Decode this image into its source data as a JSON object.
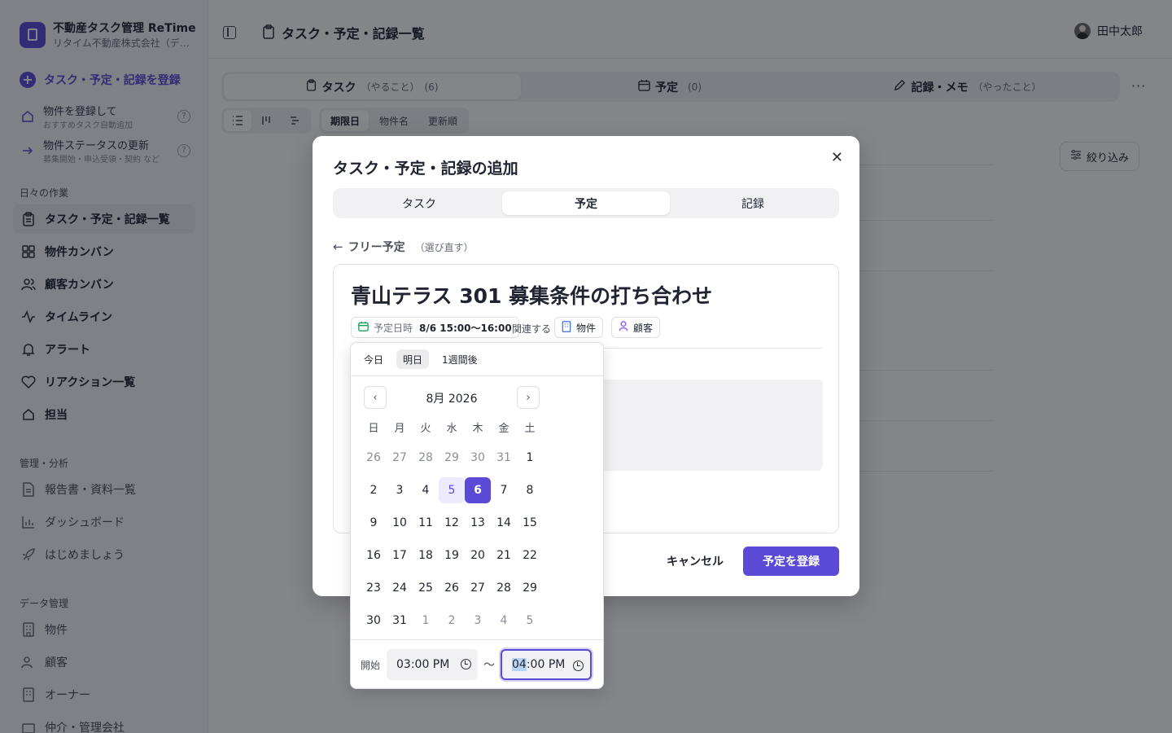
{
  "app": {
    "name": "不動産タスク管理 ReTime",
    "company": "リタイム不動産株式会社（デ…"
  },
  "sidebar": {
    "primary_cta": "タスク・予定・記録を登録",
    "sub_ctas": [
      {
        "title": "物件を登録して",
        "subtitle": "おすすめタスク自動追加"
      },
      {
        "title": "物件ステータスの更新",
        "subtitle": "募集開始・申込受領・契約 など"
      }
    ],
    "help_glyph": "?",
    "sections": [
      {
        "title": "日々の作業",
        "items": [
          "タスク・予定・記録一覧",
          "物件カンバン",
          "顧客カンバン",
          "タイムライン",
          "アラート",
          "リアクション一覧",
          "担当"
        ]
      },
      {
        "title": "管理・分析",
        "items": [
          "報告書・資料一覧",
          "ダッシュボード",
          "はじめましょう"
        ]
      },
      {
        "title": "データ管理",
        "items": [
          "物件",
          "顧客",
          "オーナー",
          "仲介・管理会社"
        ]
      }
    ]
  },
  "header": {
    "title": "タスク・予定・記録一覧",
    "user_name": "田中太郎"
  },
  "main": {
    "tabs": [
      {
        "label": "タスク",
        "sub": "（やること）",
        "count": "(6)"
      },
      {
        "label": "予定",
        "sub": "",
        "count": "(0)"
      },
      {
        "label": "記録・メモ",
        "sub": "（やったこと）",
        "count": ""
      }
    ],
    "sort_options": [
      "期限日",
      "物件名",
      "更新順"
    ],
    "filter_label": "絞り込み",
    "more_glyph": "···"
  },
  "modal": {
    "title": "タスク・予定・記録の追加",
    "close_glyph": "✕",
    "segments": [
      "タスク",
      "予定",
      "記録"
    ],
    "back_label": "フリー予定",
    "back_hint": "（選び直す）",
    "event_title": "青山テラス 301 募集条件の打ち合わせ",
    "schedule_key": "予定日時",
    "schedule_value": "8/6 15:00〜16:00",
    "relate_label": "関連する",
    "relate_property": "物件",
    "relate_customer": "顧客",
    "cancel_label": "キャンセル",
    "submit_label": "予定を登録"
  },
  "datepicker": {
    "quick": [
      "今日",
      "明日",
      "1週間後"
    ],
    "month_label": "8月 2026",
    "prev_glyph": "‹",
    "next_glyph": "›",
    "weekdays": [
      "日",
      "月",
      "火",
      "水",
      "木",
      "金",
      "土"
    ],
    "weeks": [
      [
        "26",
        "27",
        "28",
        "29",
        "30",
        "31",
        "1"
      ],
      [
        "2",
        "3",
        "4",
        "5",
        "6",
        "7",
        "8"
      ],
      [
        "9",
        "10",
        "11",
        "12",
        "13",
        "14",
        "15"
      ],
      [
        "16",
        "17",
        "18",
        "19",
        "20",
        "21",
        "22"
      ],
      [
        "23",
        "24",
        "25",
        "26",
        "27",
        "28",
        "29"
      ],
      [
        "30",
        "31",
        "1",
        "2",
        "3",
        "4",
        "5"
      ]
    ],
    "today": "5",
    "selected": "6",
    "start_label": "開始",
    "start_time": "03:00 PM",
    "end_time_highlight": "04",
    "end_time_rest": ":00 PM",
    "range_sep": "〜"
  },
  "colors": {
    "accent": "#5b4ad6",
    "today_bg": "#eceafc",
    "overlay": "rgba(10,12,20,0.5)"
  }
}
